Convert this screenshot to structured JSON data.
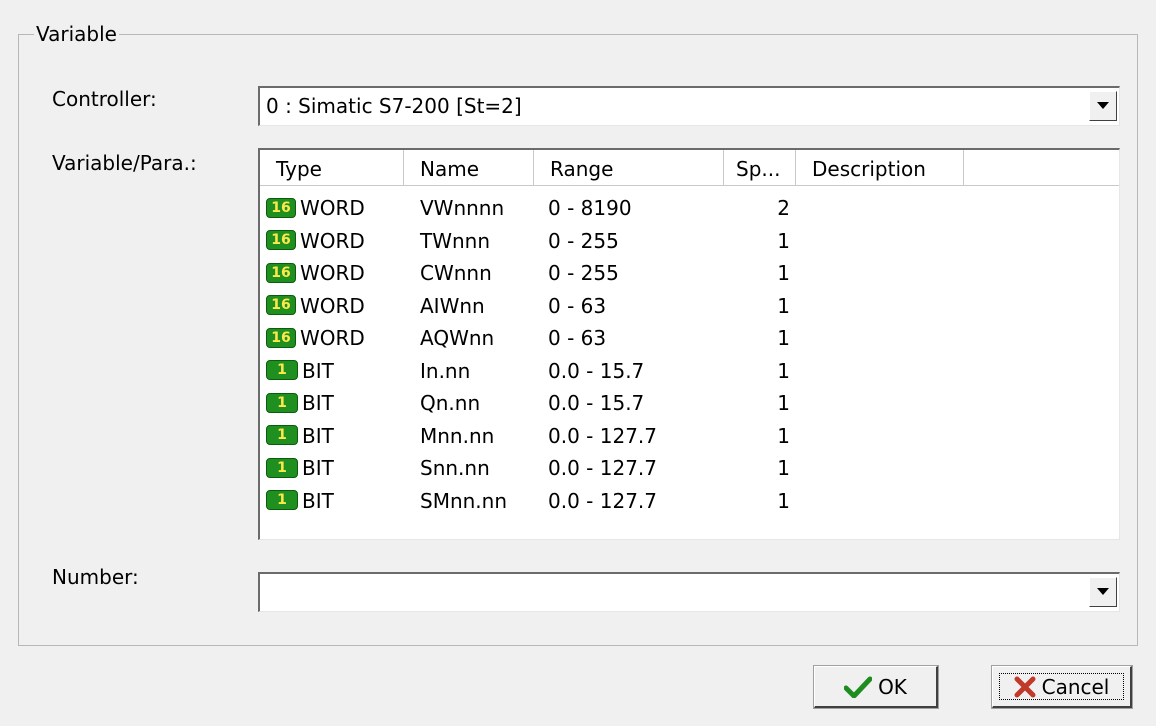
{
  "group": {
    "title": "Variable"
  },
  "labels": {
    "controller": "Controller:",
    "variable": "Variable/Para.:",
    "number": "Number:"
  },
  "controller": {
    "value": "0 : Simatic S7-200 [St=2]"
  },
  "number": {
    "value": ""
  },
  "table": {
    "columns": [
      "Type",
      "Name",
      "Range",
      "Sp...",
      "Description"
    ],
    "rows": [
      {
        "badge": "16",
        "type": "WORD",
        "name": "VWnnnn",
        "range": "0 - 8190",
        "size": "2"
      },
      {
        "badge": "16",
        "type": "WORD",
        "name": "TWnnn",
        "range": "0 - 255",
        "size": "1"
      },
      {
        "badge": "16",
        "type": "WORD",
        "name": "CWnnn",
        "range": "0 - 255",
        "size": "1"
      },
      {
        "badge": "16",
        "type": "WORD",
        "name": "AIWnn",
        "range": "0 - 63",
        "size": "1"
      },
      {
        "badge": "16",
        "type": "WORD",
        "name": "AQWnn",
        "range": "0 - 63",
        "size": "1"
      },
      {
        "badge": "1",
        "type": "BIT",
        "name": "In.nn",
        "range": "0.0 - 15.7",
        "size": "1"
      },
      {
        "badge": "1",
        "type": "BIT",
        "name": "Qn.nn",
        "range": "0.0 - 15.7",
        "size": "1"
      },
      {
        "badge": "1",
        "type": "BIT",
        "name": "Mnn.nn",
        "range": "0.0 - 127.7",
        "size": "1"
      },
      {
        "badge": "1",
        "type": "BIT",
        "name": "Snn.nn",
        "range": "0.0 - 127.7",
        "size": "1"
      },
      {
        "badge": "1",
        "type": "BIT",
        "name": "SMnn.nn",
        "range": "0.0 - 127.7",
        "size": "1"
      }
    ]
  },
  "buttons": {
    "ok": "OK",
    "cancel": "Cancel"
  },
  "icons": {
    "ok": "checkmark-icon",
    "cancel": "x-icon",
    "dropdown": "chevron-down-icon"
  },
  "colors": {
    "badge_bg": "#1f8f1f",
    "badge_text": "#ffe94a",
    "ok_check": "#1e8c1e",
    "cancel_x": "#c0392b"
  }
}
